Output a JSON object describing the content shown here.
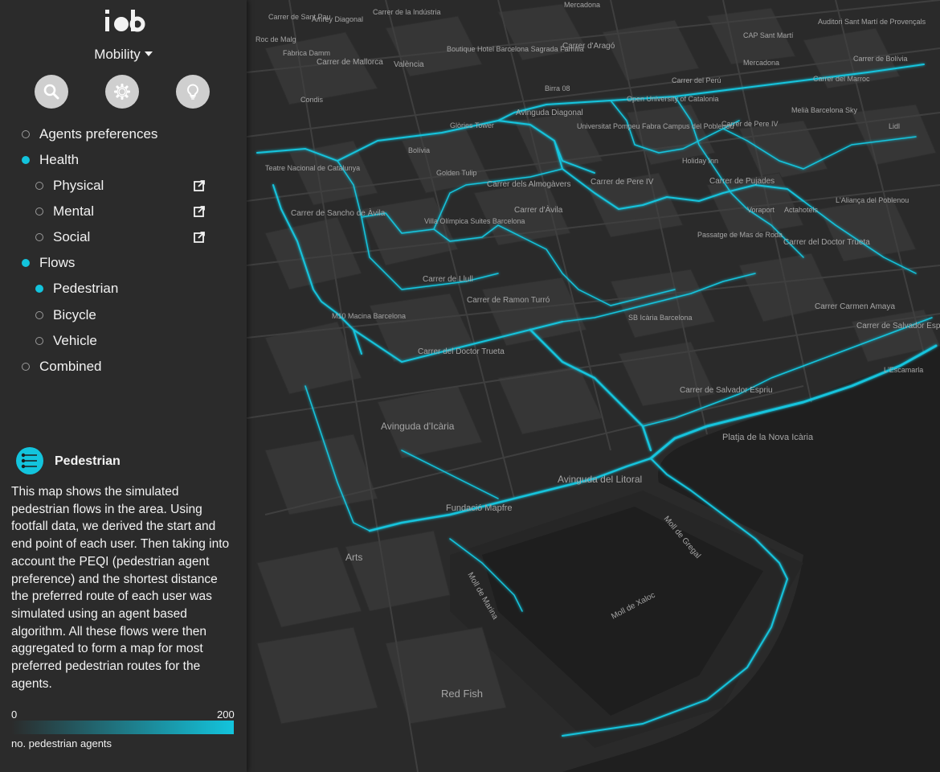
{
  "app": {
    "logo_text": "iob",
    "section_selector": "Mobility"
  },
  "toolbar": {
    "buttons": [
      "search-icon",
      "gear-icon",
      "lightbulb-icon"
    ]
  },
  "menu": {
    "agents_preferences": "Agents preferences",
    "health": "Health",
    "physical": "Physical",
    "mental": "Mental",
    "social": "Social",
    "flows": "Flows",
    "pedestrian": "Pedestrian",
    "bicycle": "Bicycle",
    "vehicle": "Vehicle",
    "combined": "Combined",
    "selected": [
      "Health",
      "Flows",
      "Pedestrian"
    ]
  },
  "info": {
    "title": "Pedestrian",
    "text": "This map shows the simulated pedestrian flows in the area. Using footfall data, we derived the start and end point of each user. Then taking into account the PEQI (pedestrian agent preference) and the shortest distance the preferred route of each user was simulated using an agent based algorithm. All these flows were then aggregated to form a map for most preferred pedestrian routes for the agents."
  },
  "legend": {
    "min": "0",
    "max": "200",
    "label": "no. pedestrian agents",
    "color_low": "#2b2b2b",
    "color_high": "#13c4dd"
  },
  "map": {
    "flow_color": "#13c4dd",
    "labels": {
      "l01": "Carrer de Sant Pau",
      "l02": "Carrer de la Indústria",
      "l03": "Mercadona",
      "l04": "Auditori Sant Martí de Provençals",
      "l05": "Amrey Diagonal",
      "l06": "Roc de Malg",
      "l07": "Fàbrica Damm",
      "l08": "Boutique Hotel Barcelona Sagrada Família",
      "l09": "Carrer d'Aragó",
      "l10": "CAP Sant Martí",
      "l11": "Carrer de Mallorca",
      "l12": "València",
      "l13": "Mercadona",
      "l14": "Carrer de Bolívia",
      "l15": "Birra 08",
      "l16": "Carrer del Perú",
      "l17": "Carrer del Marroc",
      "l18": "Condis",
      "l19": "Avinguda Diagonal",
      "l20": "Open University of Catalonia",
      "l21": "Melià Barcelona Sky",
      "l22": "Glòries Tower",
      "l23": "Universitat Pompeu Fabra Campus del Poblenou",
      "l24": "Carrer de Pere IV",
      "l25": "Lidl",
      "l26": "Teatre Nacional de Catalunya",
      "l27": "Bolívia",
      "l28": "Golden Tulip",
      "l29": "Carrer dels Almogàvers",
      "l30": "Carrer de Pere IV",
      "l31": "Holiday Inn",
      "l32": "Carrer de Pujades",
      "l33": "Carrer de Sancho de Àvila",
      "l34": "Carrer d'Àvila",
      "l35": "Villa Olímpica Suites Barcelona",
      "l36": "L'Aliança del Poblenou",
      "l37": "Voraport",
      "l38": "Actahotels",
      "l39": "Carrer del Doctor Trueta",
      "l40": "Passatge de Mas de Roda",
      "l41": "Carrer de Llull",
      "l42": "Carrer de Ramon Turró",
      "l43": "Carrer Carmen Amaya",
      "l44": "M10 Macina Barcelona",
      "l45": "SB Icària Barcelona",
      "l46": "Carrer de Salvador Espriu",
      "l47": "Carrer del Doctor Trueta",
      "l48": "Carrer de Salvador Espriu",
      "l49": "L'Escamarla",
      "l50": "Avinguda d'Icària",
      "l51": "Platja de la Nova Icària",
      "l52": "Avinguda del Litoral",
      "l53": "Fundació Mapfre",
      "l54": "Moll de Gregal",
      "l55": "Arts",
      "l56": "Moll de Marina",
      "l57": "Moll de Xaloc",
      "l58": "Red Fish"
    }
  }
}
